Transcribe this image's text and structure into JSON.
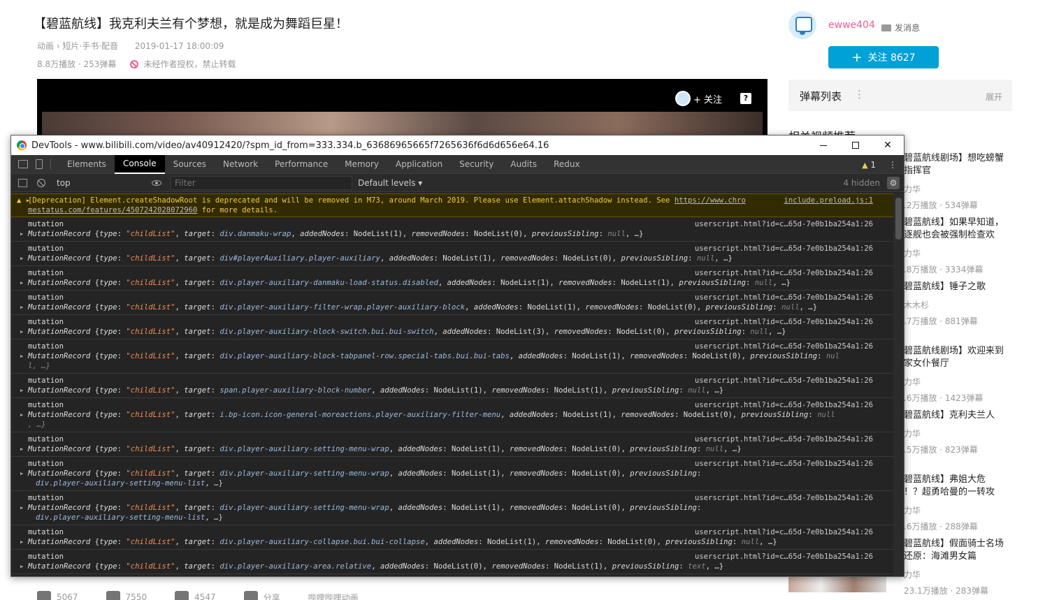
{
  "video": {
    "title": "【碧蓝航线】我克利夫兰有个梦想，就是成为舞蹈巨星！",
    "category": "动画 › 短片·手书·配音",
    "date": "2019-01-17 18:00:09",
    "stats": "8.8万播放 · 253弹幕",
    "copyright_notice": "未经作者授权，禁止转载",
    "player_follow": "+ 关注",
    "player_help": "?"
  },
  "uploader": {
    "name": "ewwe404",
    "message_label": "发消息",
    "follow_button": "关注 8627",
    "follow_plus": "+"
  },
  "danmaku_panel": {
    "title": "弹幕列表",
    "dots": "⋮",
    "expand": "展开"
  },
  "recommend": {
    "heading": "相关视频推荐",
    "items": [
      {
        "title": "碧蓝航线剧场】想吃螃蟹\n指挥官",
        "uploader": "力华",
        "stats": ".2万播放 · 534弹幕"
      },
      {
        "title": "碧蓝航线】如果早知道，\n逐舰也会被强制检查欢",
        "uploader": "力华",
        "stats": ".8万播放 · 3334弹幕"
      },
      {
        "title": "碧蓝航线】锤子之歌",
        "uploader": "木木杉",
        "stats": ".7万播放 · 881弹幕"
      },
      {
        "title": "碧蓝航线剧场】欢迎来到\n家女仆餐厅",
        "uploader": "力华",
        "stats": ".6万播放 · 1423弹幕"
      },
      {
        "title": "碧蓝航线】克利夫兰人",
        "uploader": "力华",
        "stats": ".5万播放 · 823弹幕"
      },
      {
        "title": "碧蓝航线】弗姐大危\n！？超勇哈曼的一转攻",
        "uploader": "力华",
        "stats": ".6万播放 · 288弹幕"
      },
      {
        "title": "碧蓝航线】假面骑士名场\n还原：海滩男女篇",
        "uploader": "力华",
        "stats": "23.1万播放 · 283弹幕"
      }
    ]
  },
  "bottom_bar": [
    "5067",
    "7550",
    "4547",
    "分享",
    "哔哩哔哩动画"
  ],
  "devtools": {
    "window_title": "DevTools - www.bilibili.com/video/av40912420/?spm_id_from=333.334.b_63686965665f7265636f6d6d656e64.16",
    "window_buttons": {
      "close": "✕"
    },
    "tabs": [
      "Elements",
      "Console",
      "Sources",
      "Network",
      "Performance",
      "Memory",
      "Application",
      "Security",
      "Audits",
      "Redux"
    ],
    "active_tab": "Console",
    "warning_count": "1",
    "more_icon": "⋮",
    "toolbar": {
      "context": "top",
      "filter_placeholder": "Filter",
      "levels": "Default levels ▾",
      "hidden": "4 hidden",
      "gear": "⚙"
    },
    "deprecation": {
      "text1": "[Deprecation] Element.createShadowRoot is deprecated and will be removed in M73, around March 2019. Please use Element.attachShadow instead. See ",
      "link1": "https://www.chro",
      "text2": "mestatus.com/features/4507242028072960",
      "text3": " for more details.",
      "source": "include.preload.js:1"
    },
    "entries": [
      {
        "label": "mutation",
        "loc": "userscript.html?id=c…65d-7e0b1ba254a1:26",
        "target": "div.danmaku-wrap",
        "added": "NodeList(1)",
        "removed": "NodeList(0)",
        "tail": "previousSibling",
        "tailval": "null",
        "end": ", …}"
      },
      {
        "label": "mutation",
        "loc": "userscript.html?id=c…65d-7e0b1ba254a1:26",
        "target": "div#playerAuxiliary.player-auxiliary",
        "added": "NodeList(1)",
        "removed": "NodeList(0)",
        "tail": "previousSibling",
        "tailval": "null",
        "end": ", …}"
      },
      {
        "label": "mutation",
        "loc": "userscript.html?id=c…65d-7e0b1ba254a1:26",
        "target": "div.player-auxiliary-danmaku-load-status.disabled",
        "added": "NodeList(1)",
        "removed": "NodeList(1)",
        "tail": "previousSibling",
        "tailval": "null",
        "end": ", …}"
      },
      {
        "label": "mutation",
        "loc": "userscript.html?id=c…65d-7e0b1ba254a1:26",
        "target": "div.player-auxiliary-filter-wrap.player-auxiliary-block",
        "added": "NodeList(1)",
        "removed": "NodeList(0)",
        "tail": "previousSibling",
        "tailval": "null",
        "end": ", …}"
      },
      {
        "label": "mutation",
        "loc": "userscript.html?id=c…65d-7e0b1ba254a1:26",
        "target": "div.player-auxiliary-block-switch.bui.bui-switch",
        "added": "NodeList(3)",
        "removed": "NodeList(0)",
        "tail": "previousSibling",
        "tailval": "null",
        "end": ", …}"
      },
      {
        "label": "mutation",
        "loc": "userscript.html?id=c…65d-7e0b1ba254a1:26",
        "target": "div.player-auxiliary-block-tabpanel-row.special-tabs.bui.bui-tabs",
        "added": "NodeList(1)",
        "removed": "NodeList(0)",
        "tail": "previousSibling",
        "tailval": "nul",
        "wrap": "l, …}"
      },
      {
        "label": "mutation",
        "loc": "userscript.html?id=c…65d-7e0b1ba254a1:26",
        "target": "span.player-auxiliary-block-number",
        "added": "NodeList(1)",
        "removed": "NodeList(1)",
        "tail": "previousSibling",
        "tailval": "null",
        "end": ", …}"
      },
      {
        "label": "mutation",
        "loc": "userscript.html?id=c…65d-7e0b1ba254a1:26",
        "target": "i.bp-icon.icon-general-moreactions.player-auxiliary-filter-menu",
        "added": "NodeList(1)",
        "removed": "NodeList(0)",
        "tail": "previousSibling",
        "tailval": "null",
        "wrap": ", …}"
      },
      {
        "label": "mutation",
        "loc": "userscript.html?id=c…65d-7e0b1ba254a1:26",
        "target": "div.player-auxiliary-setting-menu-wrap",
        "added": "NodeList(1)",
        "removed": "NodeList(0)",
        "tail": "previousSibling",
        "tailval": "null",
        "end": ", …}"
      },
      {
        "label": "mutation",
        "loc": "userscript.html?id=c…65d-7e0b1ba254a1:26",
        "target": "div.player-auxiliary-setting-menu-wrap",
        "added": "NodeList(1)",
        "removed": "NodeList(0)",
        "tail": "previousSibling",
        "tailval": "",
        "wrapsel": "div.player-auxiliary-setting-menu-list",
        "wrap": ", …}"
      },
      {
        "label": "mutation",
        "loc": "userscript.html?id=c…65d-7e0b1ba254a1:26",
        "target": "div.player-auxiliary-setting-menu-wrap",
        "added": "NodeList(1)",
        "removed": "NodeList(0)",
        "tail": "previousSibling",
        "tailval": "",
        "wrapsel": "div.player-auxiliary-setting-menu-list",
        "wrap": ", …}"
      },
      {
        "label": "mutation",
        "loc": "userscript.html?id=c…65d-7e0b1ba254a1:26",
        "target": "div.player-auxiliary-collapse.bui.bui-collapse",
        "added": "NodeList(1)",
        "removed": "NodeList(0)",
        "tail": "previousSibling",
        "tailval": "null",
        "end": ", …}"
      },
      {
        "label": "mutation",
        "loc": "userscript.html?id=c…65d-7e0b1ba254a1:26",
        "target": "div.player-auxiliary-area.relative",
        "added": "NodeList(0)",
        "removed": "NodeList(1)",
        "tail": "previousSibling",
        "tailval": "text",
        "end": ", …}"
      }
    ],
    "record_name": "MutationRecord",
    "type_value": "\"childList\""
  }
}
